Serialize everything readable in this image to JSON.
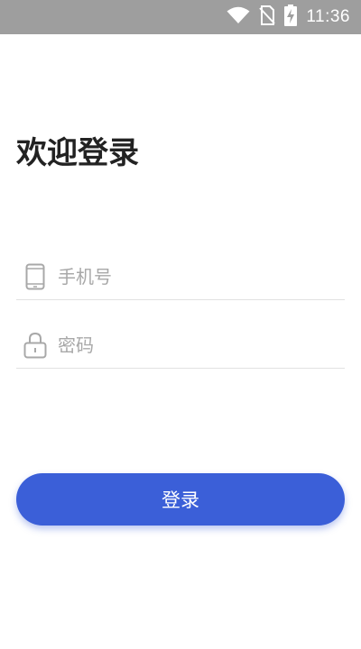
{
  "status_bar": {
    "time": "11:36",
    "icons": [
      "wifi-icon",
      "no-sim-icon",
      "battery-charging-icon"
    ]
  },
  "login": {
    "title": "欢迎登录",
    "phone_field": {
      "placeholder": "手机号",
      "value": "",
      "icon": "phone-icon"
    },
    "password_field": {
      "placeholder": "密码",
      "value": "",
      "icon": "lock-icon"
    },
    "submit_label": "登录"
  },
  "colors": {
    "status_bar_bg": "#9e9e9e",
    "accent": "#3b5fd8",
    "title_text": "#222222",
    "placeholder_text": "#a8a8a8",
    "divider": "#e2e2e2"
  }
}
